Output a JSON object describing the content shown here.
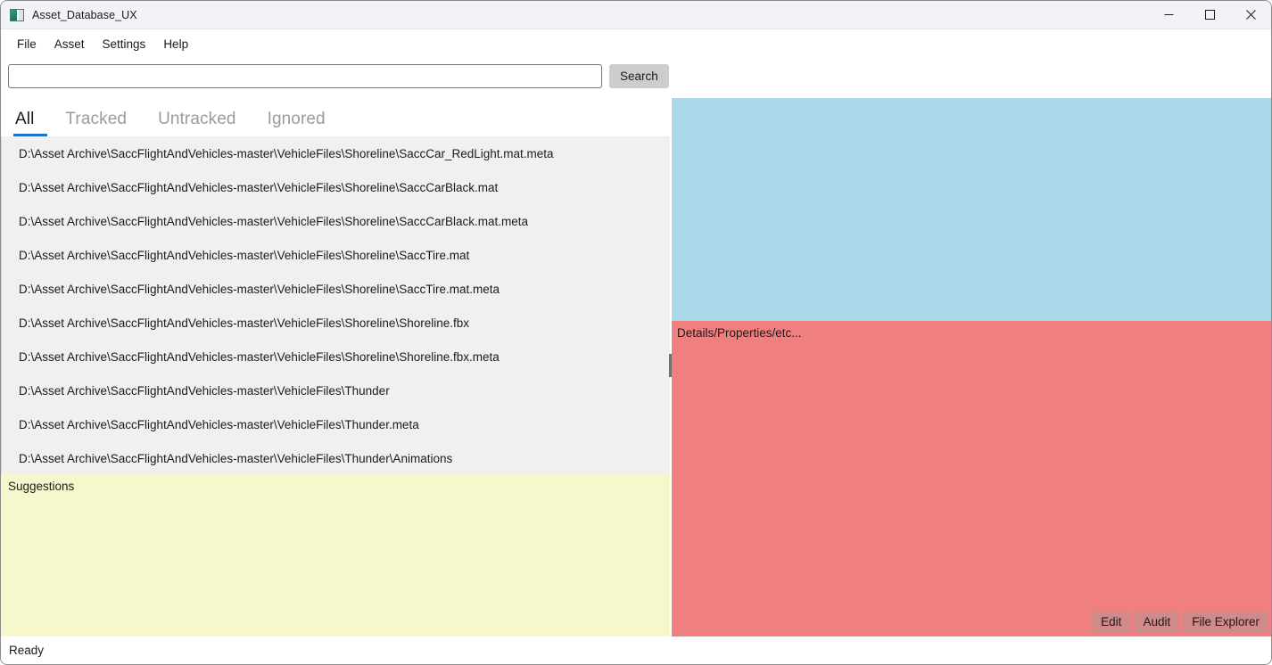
{
  "window": {
    "title": "Asset_Database_UX",
    "icon": "app-window-icon",
    "controls": {
      "minimize": "minimize-icon",
      "maximize": "maximize-icon",
      "close": "close-icon"
    }
  },
  "menubar": {
    "items": [
      {
        "label": "File"
      },
      {
        "label": "Asset"
      },
      {
        "label": "Settings"
      },
      {
        "label": "Help"
      }
    ]
  },
  "search": {
    "value": "",
    "placeholder": "",
    "button_label": "Search"
  },
  "tabs": {
    "active_index": 0,
    "items": [
      {
        "label": "All"
      },
      {
        "label": "Tracked"
      },
      {
        "label": "Untracked"
      },
      {
        "label": "Ignored"
      }
    ]
  },
  "asset_list": {
    "rows": [
      {
        "path": "D:\\Asset Archive\\SaccFlightAndVehicles-master\\VehicleFiles\\Shoreline\\SaccCar_RedLight.mat.meta"
      },
      {
        "path": "D:\\Asset Archive\\SaccFlightAndVehicles-master\\VehicleFiles\\Shoreline\\SaccCarBlack.mat"
      },
      {
        "path": "D:\\Asset Archive\\SaccFlightAndVehicles-master\\VehicleFiles\\Shoreline\\SaccCarBlack.mat.meta"
      },
      {
        "path": "D:\\Asset Archive\\SaccFlightAndVehicles-master\\VehicleFiles\\Shoreline\\SaccTire.mat"
      },
      {
        "path": "D:\\Asset Archive\\SaccFlightAndVehicles-master\\VehicleFiles\\Shoreline\\SaccTire.mat.meta"
      },
      {
        "path": "D:\\Asset Archive\\SaccFlightAndVehicles-master\\VehicleFiles\\Shoreline\\Shoreline.fbx"
      },
      {
        "path": "D:\\Asset Archive\\SaccFlightAndVehicles-master\\VehicleFiles\\Shoreline\\Shoreline.fbx.meta"
      },
      {
        "path": "D:\\Asset Archive\\SaccFlightAndVehicles-master\\VehicleFiles\\Thunder"
      },
      {
        "path": "D:\\Asset Archive\\SaccFlightAndVehicles-master\\VehicleFiles\\Thunder.meta"
      },
      {
        "path": "D:\\Asset Archive\\SaccFlightAndVehicles-master\\VehicleFiles\\Thunder\\Animations"
      }
    ]
  },
  "suggestions": {
    "title": "Suggestions"
  },
  "preview": {
    "color": "#ABD8E8"
  },
  "details": {
    "title": "Details/Properties/etc...",
    "color": "#F08080",
    "actions": [
      {
        "label": "Edit"
      },
      {
        "label": "Audit"
      },
      {
        "label": "File Explorer"
      }
    ]
  },
  "statusbar": {
    "text": "Ready"
  },
  "colors": {
    "accent": "#1a73c8",
    "preview_panel": "#ABD8E8",
    "details_panel": "#F08080",
    "suggestions_panel": "#F7F7CD",
    "list_background": "#F0F0F0"
  }
}
